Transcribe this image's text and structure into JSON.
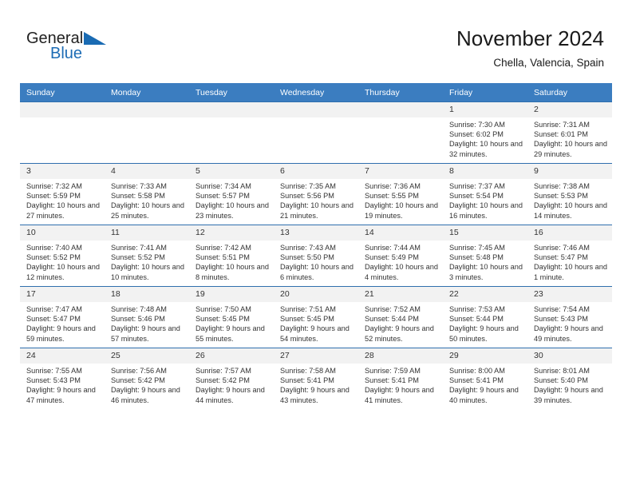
{
  "brand": {
    "name_part1": "General",
    "name_part2": "Blue",
    "icon": "triangle-logo"
  },
  "header": {
    "month_title": "November 2024",
    "location": "Chella, Valencia, Spain"
  },
  "colors": {
    "header_band": "#3b7dc0",
    "daynum_band": "#f2f2f2",
    "brand_blue": "#1d6cb5",
    "grid_line": "#2f6fae",
    "text": "#333333"
  },
  "calendar": {
    "weekdays": [
      "Sunday",
      "Monday",
      "Tuesday",
      "Wednesday",
      "Thursday",
      "Friday",
      "Saturday"
    ],
    "weeks": [
      [
        {
          "day": "",
          "empty": true
        },
        {
          "day": "",
          "empty": true
        },
        {
          "day": "",
          "empty": true
        },
        {
          "day": "",
          "empty": true
        },
        {
          "day": "",
          "empty": true
        },
        {
          "day": "1",
          "sunrise": "Sunrise: 7:30 AM",
          "sunset": "Sunset: 6:02 PM",
          "daylight": "Daylight: 10 hours and 32 minutes."
        },
        {
          "day": "2",
          "sunrise": "Sunrise: 7:31 AM",
          "sunset": "Sunset: 6:01 PM",
          "daylight": "Daylight: 10 hours and 29 minutes."
        }
      ],
      [
        {
          "day": "3",
          "sunrise": "Sunrise: 7:32 AM",
          "sunset": "Sunset: 5:59 PM",
          "daylight": "Daylight: 10 hours and 27 minutes."
        },
        {
          "day": "4",
          "sunrise": "Sunrise: 7:33 AM",
          "sunset": "Sunset: 5:58 PM",
          "daylight": "Daylight: 10 hours and 25 minutes."
        },
        {
          "day": "5",
          "sunrise": "Sunrise: 7:34 AM",
          "sunset": "Sunset: 5:57 PM",
          "daylight": "Daylight: 10 hours and 23 minutes."
        },
        {
          "day": "6",
          "sunrise": "Sunrise: 7:35 AM",
          "sunset": "Sunset: 5:56 PM",
          "daylight": "Daylight: 10 hours and 21 minutes."
        },
        {
          "day": "7",
          "sunrise": "Sunrise: 7:36 AM",
          "sunset": "Sunset: 5:55 PM",
          "daylight": "Daylight: 10 hours and 19 minutes."
        },
        {
          "day": "8",
          "sunrise": "Sunrise: 7:37 AM",
          "sunset": "Sunset: 5:54 PM",
          "daylight": "Daylight: 10 hours and 16 minutes."
        },
        {
          "day": "9",
          "sunrise": "Sunrise: 7:38 AM",
          "sunset": "Sunset: 5:53 PM",
          "daylight": "Daylight: 10 hours and 14 minutes."
        }
      ],
      [
        {
          "day": "10",
          "sunrise": "Sunrise: 7:40 AM",
          "sunset": "Sunset: 5:52 PM",
          "daylight": "Daylight: 10 hours and 12 minutes."
        },
        {
          "day": "11",
          "sunrise": "Sunrise: 7:41 AM",
          "sunset": "Sunset: 5:52 PM",
          "daylight": "Daylight: 10 hours and 10 minutes."
        },
        {
          "day": "12",
          "sunrise": "Sunrise: 7:42 AM",
          "sunset": "Sunset: 5:51 PM",
          "daylight": "Daylight: 10 hours and 8 minutes."
        },
        {
          "day": "13",
          "sunrise": "Sunrise: 7:43 AM",
          "sunset": "Sunset: 5:50 PM",
          "daylight": "Daylight: 10 hours and 6 minutes."
        },
        {
          "day": "14",
          "sunrise": "Sunrise: 7:44 AM",
          "sunset": "Sunset: 5:49 PM",
          "daylight": "Daylight: 10 hours and 4 minutes."
        },
        {
          "day": "15",
          "sunrise": "Sunrise: 7:45 AM",
          "sunset": "Sunset: 5:48 PM",
          "daylight": "Daylight: 10 hours and 3 minutes."
        },
        {
          "day": "16",
          "sunrise": "Sunrise: 7:46 AM",
          "sunset": "Sunset: 5:47 PM",
          "daylight": "Daylight: 10 hours and 1 minute."
        }
      ],
      [
        {
          "day": "17",
          "sunrise": "Sunrise: 7:47 AM",
          "sunset": "Sunset: 5:47 PM",
          "daylight": "Daylight: 9 hours and 59 minutes."
        },
        {
          "day": "18",
          "sunrise": "Sunrise: 7:48 AM",
          "sunset": "Sunset: 5:46 PM",
          "daylight": "Daylight: 9 hours and 57 minutes."
        },
        {
          "day": "19",
          "sunrise": "Sunrise: 7:50 AM",
          "sunset": "Sunset: 5:45 PM",
          "daylight": "Daylight: 9 hours and 55 minutes."
        },
        {
          "day": "20",
          "sunrise": "Sunrise: 7:51 AM",
          "sunset": "Sunset: 5:45 PM",
          "daylight": "Daylight: 9 hours and 54 minutes."
        },
        {
          "day": "21",
          "sunrise": "Sunrise: 7:52 AM",
          "sunset": "Sunset: 5:44 PM",
          "daylight": "Daylight: 9 hours and 52 minutes."
        },
        {
          "day": "22",
          "sunrise": "Sunrise: 7:53 AM",
          "sunset": "Sunset: 5:44 PM",
          "daylight": "Daylight: 9 hours and 50 minutes."
        },
        {
          "day": "23",
          "sunrise": "Sunrise: 7:54 AM",
          "sunset": "Sunset: 5:43 PM",
          "daylight": "Daylight: 9 hours and 49 minutes."
        }
      ],
      [
        {
          "day": "24",
          "sunrise": "Sunrise: 7:55 AM",
          "sunset": "Sunset: 5:43 PM",
          "daylight": "Daylight: 9 hours and 47 minutes."
        },
        {
          "day": "25",
          "sunrise": "Sunrise: 7:56 AM",
          "sunset": "Sunset: 5:42 PM",
          "daylight": "Daylight: 9 hours and 46 minutes."
        },
        {
          "day": "26",
          "sunrise": "Sunrise: 7:57 AM",
          "sunset": "Sunset: 5:42 PM",
          "daylight": "Daylight: 9 hours and 44 minutes."
        },
        {
          "day": "27",
          "sunrise": "Sunrise: 7:58 AM",
          "sunset": "Sunset: 5:41 PM",
          "daylight": "Daylight: 9 hours and 43 minutes."
        },
        {
          "day": "28",
          "sunrise": "Sunrise: 7:59 AM",
          "sunset": "Sunset: 5:41 PM",
          "daylight": "Daylight: 9 hours and 41 minutes."
        },
        {
          "day": "29",
          "sunrise": "Sunrise: 8:00 AM",
          "sunset": "Sunset: 5:41 PM",
          "daylight": "Daylight: 9 hours and 40 minutes."
        },
        {
          "day": "30",
          "sunrise": "Sunrise: 8:01 AM",
          "sunset": "Sunset: 5:40 PM",
          "daylight": "Daylight: 9 hours and 39 minutes."
        }
      ]
    ]
  }
}
